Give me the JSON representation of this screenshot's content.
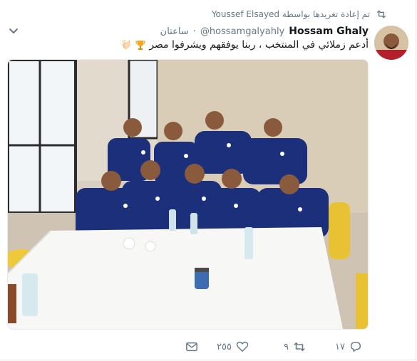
{
  "retweet_context": {
    "label": "تم إعادة تغريدها بواسطة Youssef Elsayed",
    "icon": "retweet-icon"
  },
  "tweet": {
    "fullname": "Hossam Ghaly",
    "handle": "@hossamgalyahly",
    "time": "ساعتان",
    "separator": "·",
    "text": "أدعم زملائي في المنتخب ، ربنا يوفقهم ويشرفوا مصر",
    "emojis": [
      "trophy-emoji",
      "clapping-hands-emoji"
    ]
  },
  "actions": {
    "reply_count": "١٧",
    "retweet_count": "٩",
    "like_count": "٢٥٥",
    "icons": [
      "reply-icon",
      "retweet-icon",
      "heart-icon",
      "message-icon"
    ]
  },
  "colors": {
    "text_primary": "#14171a",
    "text_secondary": "#657786",
    "border": "#e6ecf0"
  }
}
